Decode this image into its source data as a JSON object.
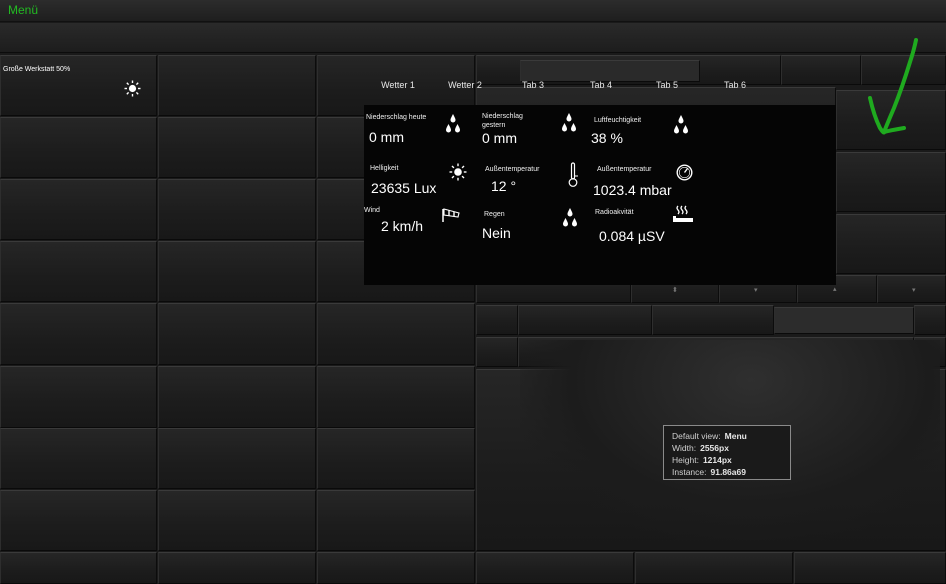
{
  "header": {
    "menu_label": "Menü"
  },
  "first_tile": {
    "label": "Große Werkstatt 50%",
    "icon": "sun-icon"
  },
  "tabs": [
    {
      "label": "Wetter 1",
      "active": true
    },
    {
      "label": "Wetter 2",
      "active": false
    },
    {
      "label": "Tab 3",
      "active": false
    },
    {
      "label": "Tab 4",
      "active": false
    },
    {
      "label": "Tab 5",
      "active": false
    },
    {
      "label": "Tab 6",
      "active": false
    }
  ],
  "weather": {
    "niederschlag_heute": {
      "label": "Niederschlag heute",
      "value": "0 mm",
      "icon": "raindrops-icon"
    },
    "niederschlag_gestern": {
      "label": "Niederschlag gestern",
      "value": "0 mm",
      "icon": "raindrops-icon"
    },
    "luftfeuchtigkeit": {
      "label": "Luftfeuchtigkeit",
      "value": "38 %",
      "icon": "raindrops-icon"
    },
    "helligkeit": {
      "label": "Helligkeit",
      "value": "23635 Lux",
      "icon": "sun-icon"
    },
    "aussentemperatur": {
      "label": "Außentemperatur",
      "value": "12 °",
      "icon": "thermometer-icon"
    },
    "luftdruck": {
      "label": "Außentemperatur",
      "value": "1023.4 mbar",
      "icon": "gauge-icon"
    },
    "wind": {
      "label": "Wind",
      "value": "2 km/h",
      "icon": "windsock-icon"
    },
    "regen": {
      "label": "Regen",
      "value": "Nein",
      "icon": "raindrops-icon"
    },
    "radioaktivitaet": {
      "label": "Radioakvität",
      "value": "0.084 µSV",
      "icon": "steam-icon"
    }
  },
  "info_box": {
    "rows": [
      {
        "key": "Default view:",
        "value": "Menu"
      },
      {
        "key": "Width:",
        "value": "2556px"
      },
      {
        "key": "Height:",
        "value": "1214px"
      },
      {
        "key": "Instance:",
        "value": "91.86a69"
      }
    ]
  },
  "colors": {
    "menu_green": "#22bb22",
    "annotation_arrow": "#1faa1f"
  }
}
